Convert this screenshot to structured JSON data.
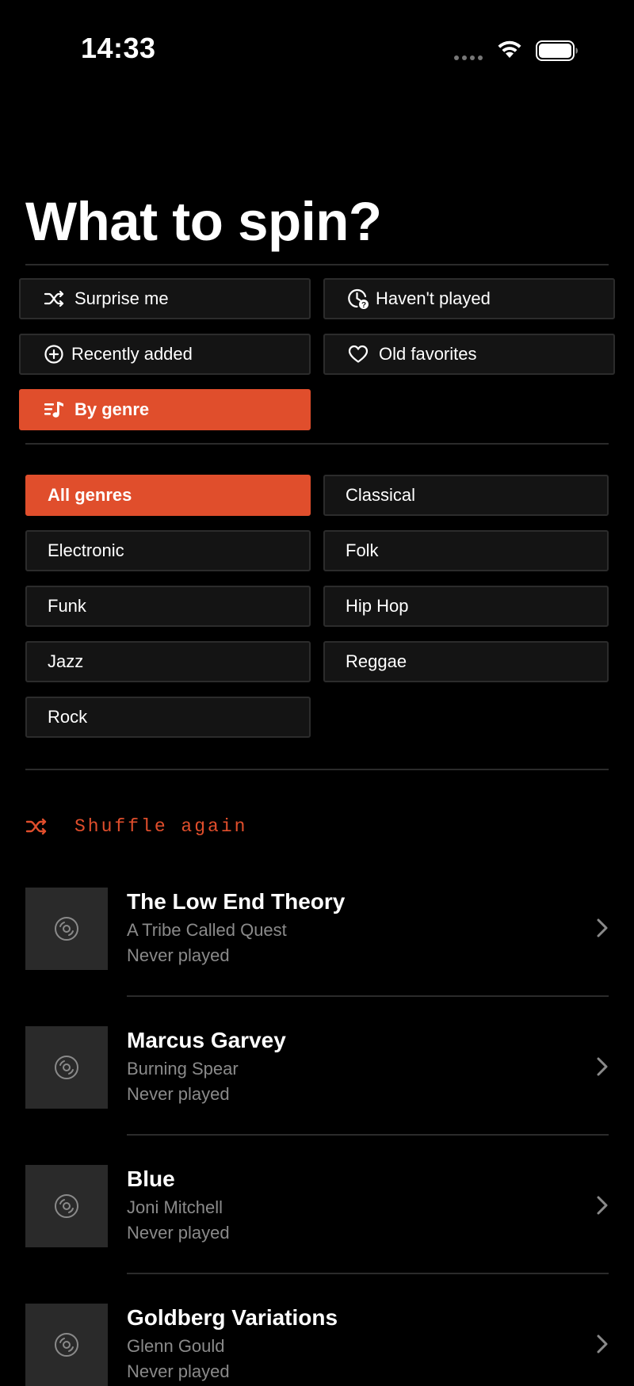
{
  "status_bar": {
    "time": "14:33"
  },
  "page": {
    "title": "What to spin?"
  },
  "modes": [
    {
      "label": "Surprise me",
      "icon": "shuffle-icon",
      "active": false
    },
    {
      "label": "Haven't played",
      "icon": "clock-question-icon",
      "active": false
    },
    {
      "label": "Recently added",
      "icon": "plus-circle-icon",
      "active": false
    },
    {
      "label": "Old favorites",
      "icon": "heart-icon",
      "active": false
    },
    {
      "label": "By genre",
      "icon": "music-list-icon",
      "active": true
    }
  ],
  "genres": [
    {
      "label": "All genres",
      "active": true
    },
    {
      "label": "Classical",
      "active": false
    },
    {
      "label": "Electronic",
      "active": false
    },
    {
      "label": "Folk",
      "active": false
    },
    {
      "label": "Funk",
      "active": false
    },
    {
      "label": "Hip Hop",
      "active": false
    },
    {
      "label": "Jazz",
      "active": false
    },
    {
      "label": "Reggae",
      "active": false
    },
    {
      "label": "Rock",
      "active": false
    }
  ],
  "shuffle": {
    "label": "Shuffle again"
  },
  "albums": [
    {
      "title": "The Low End Theory",
      "artist": "A Tribe Called Quest",
      "played": "Never played"
    },
    {
      "title": "Marcus Garvey",
      "artist": "Burning Spear",
      "played": "Never played"
    },
    {
      "title": "Blue",
      "artist": "Joni Mitchell",
      "played": "Never played"
    },
    {
      "title": "Goldberg Variations",
      "artist": "Glenn Gould",
      "played": "Never played"
    }
  ],
  "colors": {
    "accent": "#e04e2c",
    "background": "#000000",
    "surface": "#141414",
    "muted_text": "#8a8a8a"
  }
}
